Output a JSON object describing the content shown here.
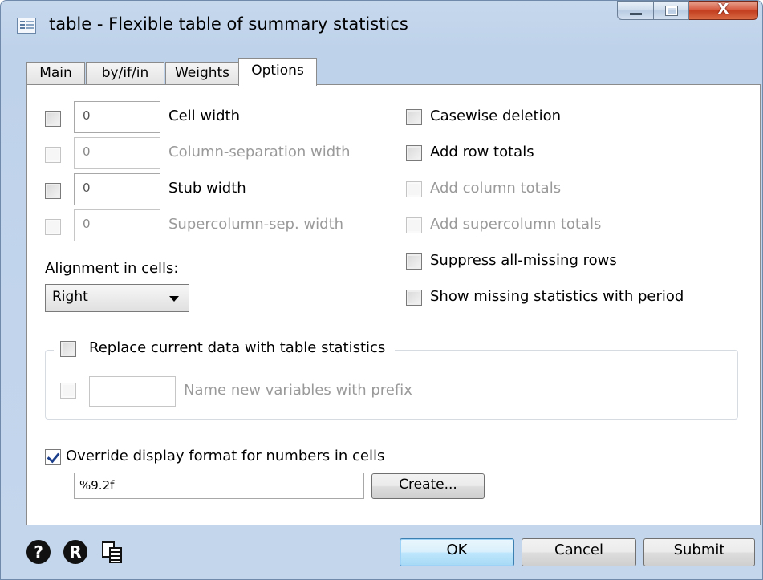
{
  "window": {
    "title": "table - Flexible table of summary statistics",
    "close_glyph": "X"
  },
  "tabs": [
    {
      "label": "Main"
    },
    {
      "label": "by/if/in"
    },
    {
      "label": "Weights"
    },
    {
      "label": "Options"
    }
  ],
  "width_options": [
    {
      "label": "Cell width",
      "value": "0",
      "enabled": true
    },
    {
      "label": "Column-separation width",
      "value": "0",
      "enabled": false
    },
    {
      "label": "Stub width",
      "value": "0",
      "enabled": true
    },
    {
      "label": "Supercolumn-sep. width",
      "value": "0",
      "enabled": false
    }
  ],
  "right_options": [
    {
      "label": "Casewise deletion",
      "enabled": true,
      "checked": false
    },
    {
      "label": "Add row totals",
      "enabled": true,
      "checked": false
    },
    {
      "label": "Add column totals",
      "enabled": false,
      "checked": false
    },
    {
      "label": "Add supercolumn totals",
      "enabled": false,
      "checked": false
    },
    {
      "label": "Suppress all-missing rows",
      "enabled": true,
      "checked": false
    },
    {
      "label": "Show missing statistics with period",
      "enabled": true,
      "checked": false
    }
  ],
  "alignment": {
    "label": "Alignment in cells:",
    "selected": "Right"
  },
  "replace_group": {
    "label": "Replace current data with table statistics",
    "checked": false,
    "prefix_label": "Name new variables with prefix",
    "prefix_value": ""
  },
  "format": {
    "label": "Override display format for numbers in cells",
    "checked": true,
    "value": "%9.2f",
    "create_label": "Create..."
  },
  "buttons": {
    "ok": "OK",
    "cancel": "Cancel",
    "submit": "Submit"
  },
  "footer_icons": {
    "help": "?",
    "reset": "R"
  }
}
